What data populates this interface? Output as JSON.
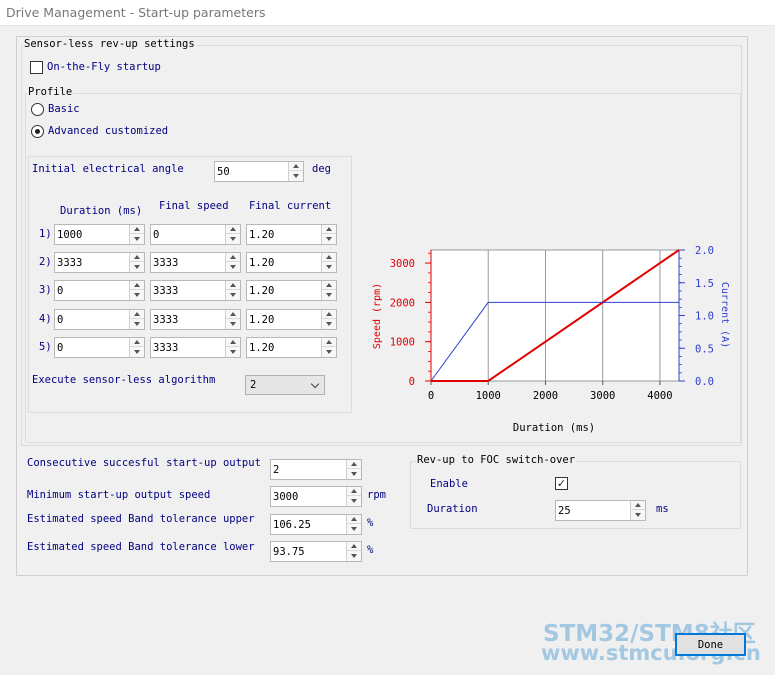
{
  "window": {
    "title": "Drive Management - Start-up parameters"
  },
  "sensorless": {
    "group_title": "Sensor-less rev-up settings",
    "on_the_fly": {
      "label": "On-the-Fly startup",
      "checked": false
    },
    "profile": {
      "title": "Profile",
      "options": [
        {
          "label": "Basic",
          "selected": false
        },
        {
          "label": "Advanced customized",
          "selected": true
        }
      ]
    },
    "initial_angle": {
      "label": "Initial electrical angle",
      "value": "50",
      "unit": "deg"
    },
    "table": {
      "headers": [
        "Duration (ms)",
        "Final speed",
        "Final current"
      ],
      "rows": [
        {
          "index": "1)",
          "duration": "1000",
          "speed": "0",
          "current": "1.20"
        },
        {
          "index": "2)",
          "duration": "3333",
          "speed": "3333",
          "current": "1.20"
        },
        {
          "index": "3)",
          "duration": "0",
          "speed": "3333",
          "current": "1.20"
        },
        {
          "index": "4)",
          "duration": "0",
          "speed": "3333",
          "current": "1.20"
        },
        {
          "index": "5)",
          "duration": "0",
          "speed": "3333",
          "current": "1.20"
        }
      ]
    },
    "execute": {
      "label": "Execute sensor-less algorithm",
      "value": "2"
    }
  },
  "chart_data": {
    "type": "line",
    "title": "",
    "xlabel": "Duration (ms)",
    "ylabel": "Speed (rpm)",
    "y2label": "Current (A)",
    "xlim": [
      0,
      4333
    ],
    "ylim": [
      0,
      3333
    ],
    "y2lim": [
      0,
      2.0
    ],
    "x_ticks": [
      "0",
      "1000",
      "2000",
      "3000",
      "4000"
    ],
    "y_ticks": [
      "0",
      "1000",
      "2000",
      "3000"
    ],
    "y2_ticks": [
      "0.0",
      "0.5",
      "1.0",
      "1.5",
      "2.0"
    ],
    "grid": "vertical",
    "series": [
      {
        "axis": "left",
        "color": "#e00000",
        "x": [
          0,
          1000,
          4333
        ],
        "y": [
          0,
          0,
          3333
        ]
      },
      {
        "axis": "right",
        "color": "#3040d0",
        "x": [
          0,
          1000,
          4333
        ],
        "y": [
          0,
          1.2,
          1.2
        ]
      }
    ]
  },
  "consecutive": {
    "label": "Consecutive succesful start-up output",
    "value": "2"
  },
  "min_speed": {
    "label": "Minimum start-up output speed",
    "value": "3000",
    "unit": "rpm"
  },
  "tol_upper": {
    "label": "Estimated speed Band tolerance upper",
    "value": "106.25",
    "unit": "%"
  },
  "tol_lower": {
    "label": "Estimated speed Band tolerance lower",
    "value": "93.75",
    "unit": "%"
  },
  "revup": {
    "title": "Rev-up to FOC switch-over",
    "enable": {
      "label": "Enable",
      "checked": true,
      "mark": "✓"
    },
    "duration": {
      "label": "Duration",
      "value": "25",
      "unit": "ms"
    }
  },
  "done_label": "Done",
  "watermark": {
    "line1": "STM32/STM8社区",
    "line2": "www.stmcu.org.cn"
  },
  "colors": {
    "label": "#000080",
    "speed": "#e00000",
    "current": "#3040d0",
    "accent": "#0078d7"
  }
}
